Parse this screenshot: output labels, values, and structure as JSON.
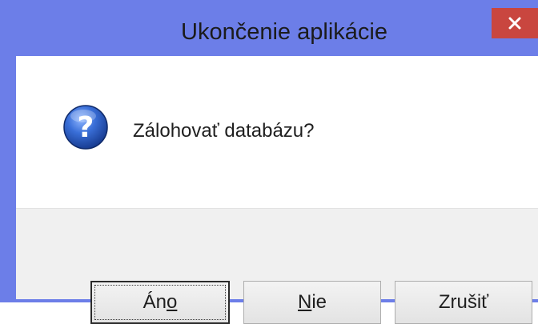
{
  "window": {
    "title": "Ukončenie aplikácie",
    "close_glyph": "✕",
    "title_color": "#6c7ee8",
    "close_color": "#c9463f"
  },
  "message": {
    "icon": "question-icon",
    "text": "Zálohovať databázu?"
  },
  "buttons": {
    "yes": {
      "pre": "Án",
      "accel": "o",
      "post": ""
    },
    "no": {
      "pre": "",
      "accel": "N",
      "post": "ie"
    },
    "cancel": {
      "label": "Zrušiť"
    }
  }
}
